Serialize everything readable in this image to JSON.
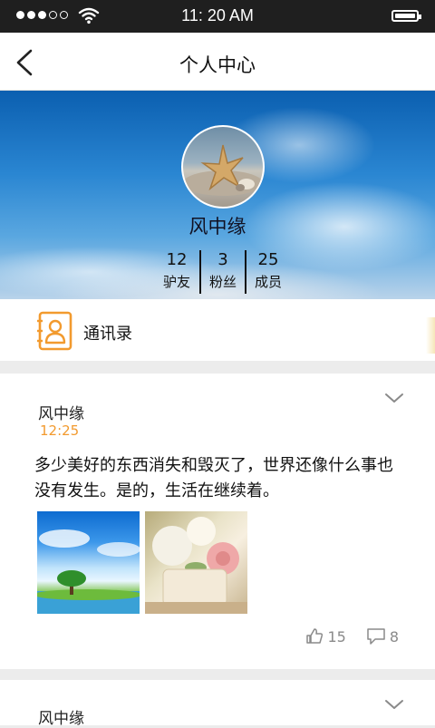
{
  "status_bar": {
    "time": "11: 20 AM"
  },
  "nav": {
    "title": "个人中心"
  },
  "profile": {
    "name": "风中缘",
    "stats": [
      {
        "value": "12",
        "label": "驴友"
      },
      {
        "value": "3",
        "label": "粉丝"
      },
      {
        "value": "25",
        "label": "成员"
      }
    ]
  },
  "contacts": {
    "label": "通讯录"
  },
  "posts": [
    {
      "author": "风中缘",
      "time": "12:25",
      "text": "多少美好的东西消失和毁灭了，世界还像什么事也没有发生。是的，生活在继续着。",
      "likes": "15",
      "comments": "8"
    },
    {
      "author": "风中缘"
    }
  ],
  "colors": {
    "accent": "#f29a2e",
    "status_bar": "#1f1f1f"
  },
  "icons": [
    "signal-icon",
    "wifi-icon",
    "battery-icon",
    "back-icon",
    "contacts-icon",
    "chevron-down-icon",
    "like-icon",
    "comment-icon"
  ]
}
